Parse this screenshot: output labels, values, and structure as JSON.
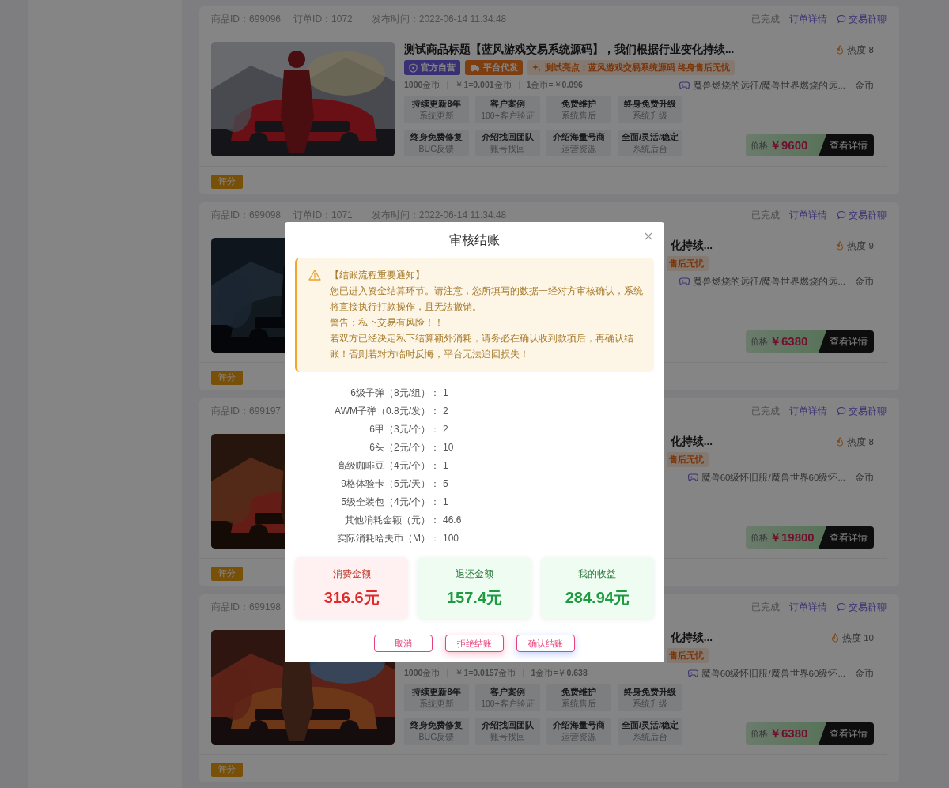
{
  "orders": [
    {
      "product_id": "商品ID：699096",
      "order_id": "订单ID：1072",
      "published": "发布时间：2022-06-14 11:34:48",
      "status": "已完成",
      "detail_link": "订单详情",
      "chat_link": "交易群聊",
      "image": {
        "kind": "picture"
      },
      "title": "测试商品标题【蓝风游戏交易系统源码】，我们根据行业变化持续...",
      "tags": [
        {
          "kind": "official",
          "label": "官方自营"
        },
        {
          "kind": "shipping",
          "label": "平台代发"
        },
        {
          "kind": "highlight",
          "label": "测试亮点：蓝风游戏交易系统源码 终身售后无忧"
        }
      ],
      "rates": [
        "**1000**金币",
        "￥1=**0.001**金币",
        "**1**金币=￥**0.096**"
      ],
      "features": [
        {
          "title": "持续更新8年",
          "subtitle": "系统更新"
        },
        {
          "title": "客户案例",
          "subtitle": "100+客户验证"
        },
        {
          "title": "免费维护",
          "subtitle": "系统售后"
        },
        {
          "title": "终身免费升级",
          "subtitle": "系统升级"
        },
        {
          "title": "终身免费修复",
          "subtitle": "BUG反馈"
        },
        {
          "title": "介绍找回团队",
          "subtitle": "账号找回"
        },
        {
          "title": "介绍海量号商",
          "subtitle": "运营资源"
        },
        {
          "title": "全面/灵活/稳定",
          "subtitle": "系统后台"
        }
      ],
      "heat": "热度 8",
      "game": "魔兽燃烧的远征/魔兽世界燃烧的远...",
      "currency": "金币",
      "price_label": "价格",
      "price": "￥9600",
      "view_button": "查看详情",
      "rating_button": "评分"
    },
    {
      "product_id": "商品ID：699098",
      "order_id": "订单ID：1071",
      "published": "发布时间：2022-06-14 11:34:48",
      "status": "已完成",
      "detail_link": "订单详情",
      "chat_link": "交易群聊",
      "image": {
        "kind": "picture"
      },
      "title": "化持续...",
      "tags": [
        {
          "kind": "highlight",
          "label": "售后无忧"
        }
      ],
      "heat": "热度 9",
      "game": "魔兽燃烧的远征/魔兽世界燃烧的远...",
      "currency": "金币",
      "price_label": "价格",
      "price": "￥6380",
      "view_button": "查看详情",
      "rating_button": "评分"
    },
    {
      "product_id": "商品ID：699197",
      "status": "已完成",
      "detail_link": "订单详情",
      "chat_link": "交易群聊",
      "image": {
        "kind": "picture"
      },
      "title": "化持续...",
      "tags": [
        {
          "kind": "highlight",
          "label": "售后无忧"
        }
      ],
      "heat": "热度 8",
      "game": "魔兽60级怀旧服/魔兽世界60级怀...",
      "currency": "金币",
      "price_label": "价格",
      "price": "￥19800",
      "view_button": "查看详情",
      "rating_button": "评分"
    },
    {
      "product_id": "商品ID：699198",
      "status": "已完成",
      "detail_link": "订单详情",
      "chat_link": "交易群聊",
      "image": {
        "kind": "picture"
      },
      "title": "化持续...",
      "tags": [
        {
          "kind": "highlight",
          "label": "售后无忧"
        }
      ],
      "rates": [
        "**1000**金币",
        "￥1=**0.0157**金币",
        "**1**金币=￥**0.638**"
      ],
      "features": [
        {
          "title": "持续更新8年",
          "subtitle": "系统更新"
        },
        {
          "title": "客户案例",
          "subtitle": "100+客户验证"
        },
        {
          "title": "免费维护",
          "subtitle": "系统售后"
        },
        {
          "title": "终身免费升级",
          "subtitle": "系统升级"
        },
        {
          "title": "终身免费修复",
          "subtitle": "BUG反馈"
        },
        {
          "title": "介绍找回团队",
          "subtitle": "账号找回"
        },
        {
          "title": "介绍海量号商",
          "subtitle": "运营资源"
        },
        {
          "title": "全面/灵活/稳定",
          "subtitle": "系统后台"
        }
      ],
      "heat": "热度 10",
      "game": "魔兽60级怀旧服/魔兽世界60级怀...",
      "currency": "金币",
      "price_label": "价格",
      "price": "￥6380",
      "view_button": "查看详情",
      "rating_button": "评分"
    }
  ],
  "dialog": {
    "title": "审核结账",
    "notice": {
      "title": "【结账流程重要通知】",
      "paragraphs": [
        "您已进入资金结算环节。请注意，您所填写的数据一经对方审核确认，系统将直接执行打款操作，且无法撤销。",
        "警告：私下交易有风险！！",
        "若双方已经决定私下结算额外消耗，请务必在确认收到款项后，再确认结账！否则若对方临时反悔，平台无法追回损失！"
      ]
    },
    "items": [
      {
        "label": "6级子弹（8元/组）：",
        "value": "1"
      },
      {
        "label": "AWM子弹（0.8元/发）：",
        "value": "2"
      },
      {
        "label": "6甲（3元/个）：",
        "value": "2"
      },
      {
        "label": "6头（2元/个）：",
        "value": "10"
      },
      {
        "label": "高级咖啡豆（4元/个）：",
        "value": "1"
      },
      {
        "label": "9格体验卡（5元/天）：",
        "value": "5"
      },
      {
        "label": "5级全装包（4元/个）：",
        "value": "1"
      },
      {
        "label": "其他消耗金额（元）：",
        "value": "46.6"
      },
      {
        "label": "实际消耗哈夫币（M）：",
        "value": "100"
      }
    ],
    "summary": [
      {
        "kind": "expense",
        "label": "消费金额",
        "value": "316.6元"
      },
      {
        "kind": "refund",
        "label": "退还金额",
        "value": "157.4元"
      },
      {
        "kind": "income",
        "label": "我的收益",
        "value": "284.94元"
      }
    ],
    "buttons": [
      {
        "kind": "cancel",
        "label": "取消"
      },
      {
        "kind": "reject",
        "label": "拒绝结账"
      },
      {
        "kind": "confirm",
        "label": "确认结账"
      }
    ]
  }
}
